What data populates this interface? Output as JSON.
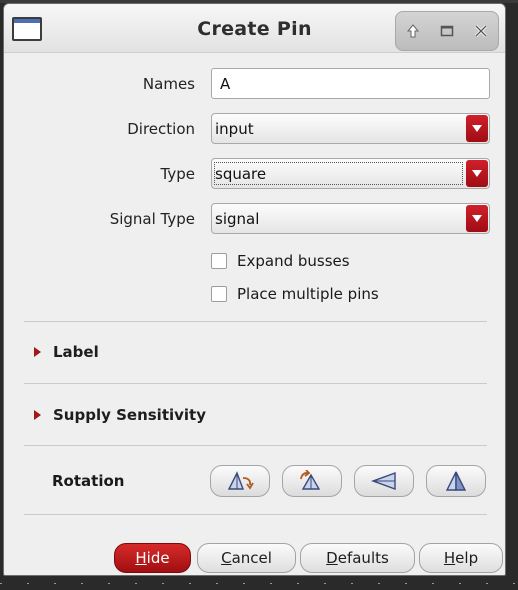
{
  "window": {
    "title": "Create Pin",
    "controls": [
      "up-arrow-icon",
      "maximize-icon",
      "close-icon"
    ]
  },
  "form": {
    "names_label": "Names",
    "names_value": "A",
    "direction_label": "Direction",
    "direction_value": "input",
    "type_label": "Type",
    "type_value": "square",
    "signal_type_label": "Signal Type",
    "signal_type_value": "signal",
    "expand_busses_label": "Expand busses",
    "expand_busses_checked": false,
    "place_multiple_label": "Place multiple pins",
    "place_multiple_checked": false
  },
  "sections": {
    "label_title": "Label",
    "supply_title": "Supply Sensitivity",
    "rotation_title": "Rotation"
  },
  "rotation_buttons": [
    "rotate-icon",
    "rotate-flip-icon",
    "mirror-horizontal-icon",
    "mirror-vertical-icon"
  ],
  "buttons": {
    "hide_first": "H",
    "hide_rest": "ide",
    "cancel_first": "C",
    "cancel_rest": "ancel",
    "defaults_first": "D",
    "defaults_rest": "efaults",
    "help_first": "H",
    "help_rest": "elp"
  },
  "colors": {
    "accent": "#b51a1e",
    "dialog_bg": "#efefef"
  }
}
